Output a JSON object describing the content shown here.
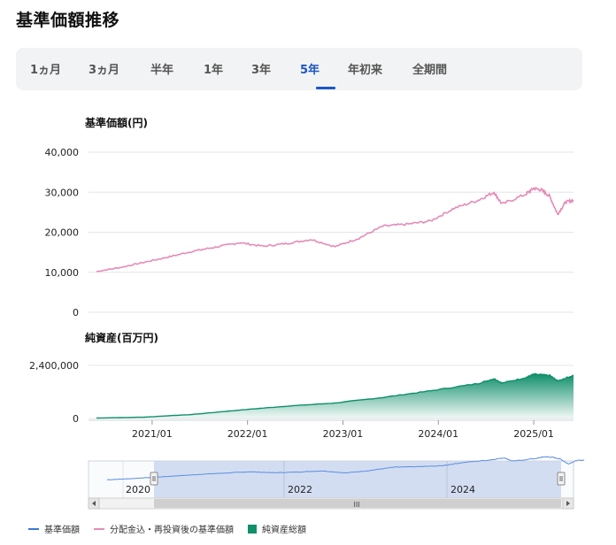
{
  "page": {
    "title": "基準価額推移"
  },
  "tabs": [
    {
      "label": "1ヵ月"
    },
    {
      "label": "3ヵ月"
    },
    {
      "label": "半年"
    },
    {
      "label": "1年"
    },
    {
      "label": "3年"
    },
    {
      "label": "5年",
      "active": true
    },
    {
      "label": "年初来"
    },
    {
      "label": "全期間"
    }
  ],
  "colors": {
    "accent": "#1a57c4",
    "nav_line": "#e58bb8",
    "net_assets_fill": "#0f8f6a",
    "navigator_line": "#5b8ee0",
    "navigator_window": "#c9d6ee"
  },
  "navigator": {
    "labels": [
      "2020",
      "2022",
      "2024"
    ],
    "scroll_handle": "III"
  },
  "legend": [
    {
      "label": "基準価額",
      "color": "#3a78d8",
      "kind": "line"
    },
    {
      "label": "分配金込・再投資後の基準価額",
      "color": "#e58bb8",
      "kind": "line"
    },
    {
      "label": "純資産総額",
      "color": "#0f8f6a",
      "kind": "box"
    }
  ],
  "chart_data": [
    {
      "type": "line",
      "title": "基準価額(円)",
      "x_ticks": [
        "2021/01",
        "2022/01",
        "2023/01",
        "2024/01",
        "2025/01"
      ],
      "y_ticks": [
        "0",
        "10,000",
        "20,000",
        "30,000",
        "40,000"
      ],
      "ylim": [
        0,
        40000
      ],
      "series": [
        {
          "x": [
            "2020/06",
            "2020/09",
            "2020/12",
            "2021/03",
            "2021/06",
            "2021/09",
            "2021/12",
            "2022/03",
            "2022/06",
            "2022/09",
            "2022/12",
            "2023/03",
            "2023/06",
            "2023/09",
            "2023/12",
            "2024/03",
            "2024/06",
            "2024/08",
            "2024/09",
            "2024/12",
            "2025/01",
            "2025/02",
            "2025/03",
            "2025/04",
            "2025/05",
            "2025/06"
          ],
          "values": [
            10200,
            11200,
            12500,
            13800,
            15200,
            16300,
            17400,
            16500,
            17200,
            18200,
            16400,
            18500,
            21500,
            22000,
            22800,
            26000,
            28000,
            30000,
            27000,
            29500,
            31000,
            30500,
            29000,
            24500,
            27500,
            28000
          ]
        }
      ]
    },
    {
      "type": "area",
      "title": "純資産(百万円)",
      "x_ticks": [
        "2021/01",
        "2022/01",
        "2023/01",
        "2024/01",
        "2025/01"
      ],
      "y_ticks": [
        "0",
        "2,400,000"
      ],
      "ylim": [
        0,
        2400000
      ],
      "series": [
        {
          "x": [
            "2020/06",
            "2020/12",
            "2021/06",
            "2021/12",
            "2022/06",
            "2022/12",
            "2023/06",
            "2023/12",
            "2024/06",
            "2024/08",
            "2024/09",
            "2024/12",
            "2025/01",
            "2025/03",
            "2025/04",
            "2025/06"
          ],
          "values": [
            20000,
            60000,
            180000,
            380000,
            560000,
            700000,
            950000,
            1250000,
            1580000,
            1800000,
            1600000,
            1850000,
            2000000,
            1950000,
            1700000,
            1950000
          ]
        }
      ]
    }
  ]
}
